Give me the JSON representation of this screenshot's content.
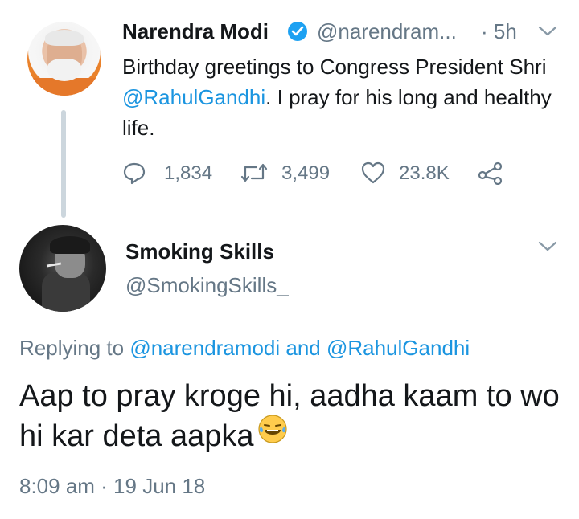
{
  "original_tweet": {
    "author_name": "Narendra Modi",
    "handle": "@narendram...",
    "time": "· 5h",
    "text_before": "Birthday greetings to Congress President Shri ",
    "mention": "@RahulGandhi",
    "text_after": ". I pray for his long and healthy life.",
    "replies": "1,834",
    "retweets": "3,499",
    "likes": "23.8K"
  },
  "reply_tweet": {
    "author_name": "Smoking Skills",
    "handle": "@SmokingSkills_",
    "replying_prefix": "Replying to ",
    "replying_to_1": "@narendramodi",
    "replying_and": " and ",
    "replying_to_2": "@RahulGandhi",
    "text": "Aap to pray kroge hi, aadha kaam to wo hi kar deta aapka",
    "timestamp": "8:09 am · 19 Jun 18"
  },
  "colors": {
    "text": "#14171a",
    "muted": "#657786",
    "link": "#1b95e0",
    "verified": "#1da1f2",
    "thread_line": "#ccd6dd"
  },
  "icons": [
    "verified-badge-icon",
    "chevron-down-icon",
    "reply-icon",
    "retweet-icon",
    "like-icon",
    "share-icon",
    "laughing-emoji-icon"
  ]
}
